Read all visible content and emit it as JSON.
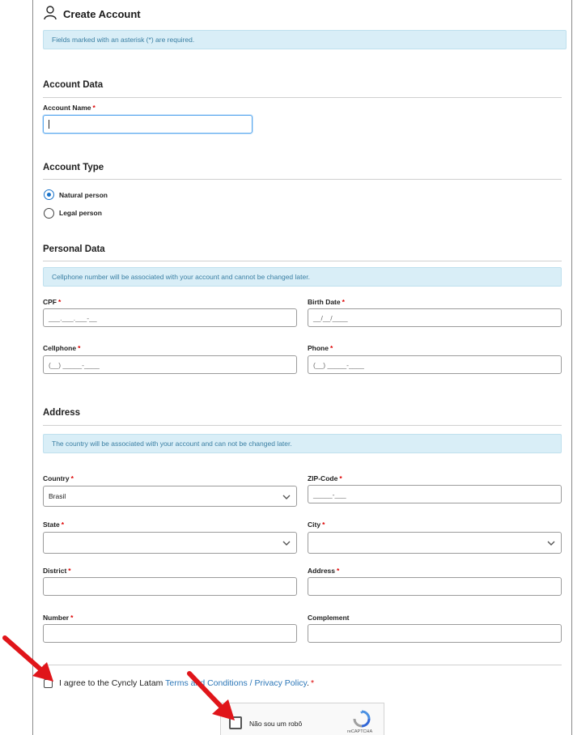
{
  "header": {
    "title": "Create Account",
    "notice": "Fields marked with an asterisk (*) are required."
  },
  "account_data": {
    "heading": "Account Data",
    "name_label": "Account Name",
    "name_value": ""
  },
  "account_type": {
    "heading": "Account Type",
    "options": [
      "Natural person",
      "Legal person"
    ],
    "selected": "Natural person"
  },
  "personal": {
    "heading": "Personal Data",
    "notice": "Cellphone number will be associated with your account and cannot be changed later.",
    "cpf_label": "CPF",
    "cpf_placeholder": "___.___.___-__",
    "birth_label": "Birth Date",
    "birth_placeholder": "__/__/____",
    "cell_label": "Cellphone",
    "cell_placeholder": "(__) _____-____",
    "phone_label": "Phone",
    "phone_placeholder": "(__) _____-____"
  },
  "address": {
    "heading": "Address",
    "notice": "The country will be associated with your account and can not be changed later.",
    "country_label": "Country",
    "country_value": "Brasil",
    "zip_label": "ZIP-Code",
    "zip_placeholder": "_____-___",
    "state_label": "State",
    "state_value": "",
    "city_label": "City",
    "city_value": "",
    "district_label": "District",
    "address_label": "Address",
    "number_label": "Number",
    "complement_label": "Complement"
  },
  "terms": {
    "prefix": "I agree to the Cyncly Latam ",
    "link": "Terms and Conditions / Privacy Policy",
    "suffix": "."
  },
  "recaptcha": {
    "label": "Não sou um robô",
    "brand": "reCAPTCHA"
  },
  "colors": {
    "accent": "#1a73c9",
    "alert_bg": "#d9eef7",
    "link": "#2c77b8",
    "required": "#dd0000",
    "arrow": "#e0151a"
  }
}
